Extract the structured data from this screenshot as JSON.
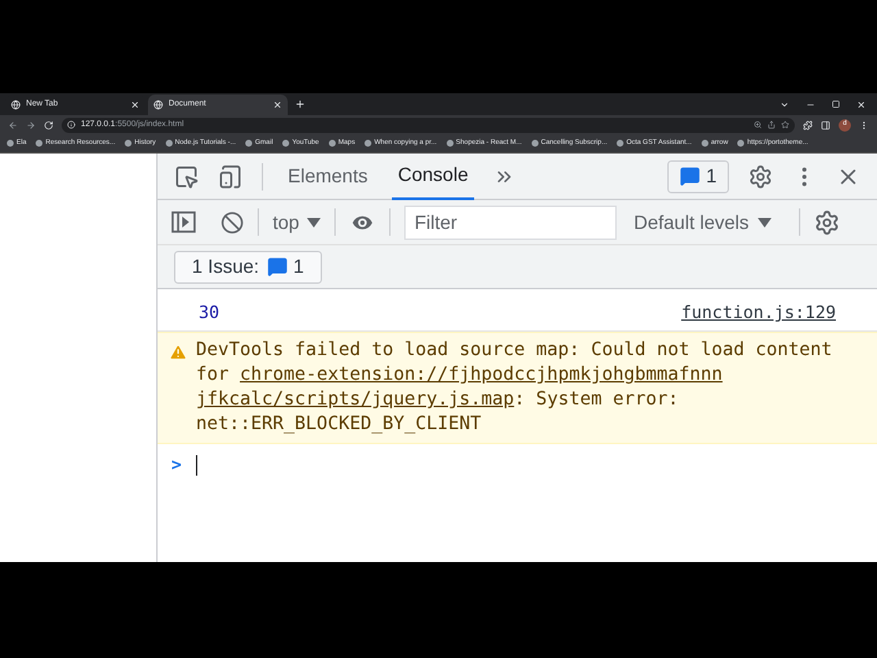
{
  "browser": {
    "tabs": [
      {
        "title": "New Tab",
        "selected": false
      },
      {
        "title": "Document",
        "selected": true
      }
    ],
    "address": {
      "host": "127.0.0.1",
      "rest": ":5500/js/index.html"
    },
    "profile": "d",
    "bookmarks": [
      "Ela",
      "Research Resources...",
      "History",
      "Node.js Tutorials -...",
      "Gmail",
      "YouTube",
      "Maps",
      "When copying a pr...",
      "Shopezia - React M...",
      "Cancelling Subscrip...",
      "Octa GST Assistant...",
      "arrow",
      "https://portotheme..."
    ]
  },
  "devtools": {
    "panel_tabs": [
      {
        "label": "Elements",
        "selected": false
      },
      {
        "label": "Console",
        "selected": true
      }
    ],
    "issues_count": "1",
    "context": "top",
    "filter": {
      "placeholder": "Filter"
    },
    "levels": "Default levels",
    "issues_button": {
      "label": "1 Issue:",
      "count": "1"
    },
    "messages": [
      {
        "kind": "log",
        "text": "30",
        "source": "function.js:129"
      },
      {
        "kind": "warning",
        "text": "DevTools failed to load source map: Could not load content for ",
        "link_lines": [
          "chrome-extension://fjhpodccjhpmkjohgbmmafnnn",
          "jfkcalc/scripts/jquery.js.map"
        ],
        "after": ": System error: net::ERR_BLOCKED_BY_CLIENT"
      }
    ],
    "prompt": ">"
  }
}
